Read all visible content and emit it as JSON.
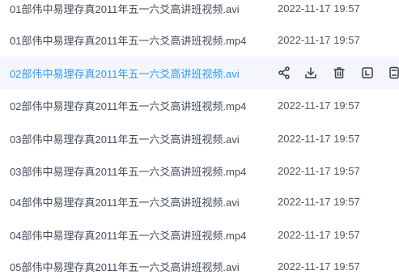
{
  "files": [
    {
      "name": "01部伟中易理存真2011年五一六爻高讲班视频.avi",
      "modified": "2022-11-17  19:57"
    },
    {
      "name": "01部伟中易理存真2011年五一六爻高讲班视频.mp4",
      "modified": "2022-11-17  19:57"
    },
    {
      "name": "02部伟中易理存真2011年五一六爻高讲班视频.avi",
      "modified": "",
      "hovered": true
    },
    {
      "name": "02部伟中易理存真2011年五一六爻高讲班视频.mp4",
      "modified": "2022-11-17  19:57"
    },
    {
      "name": "03部伟中易理存真2011年五一六爻高讲班视频.avi",
      "modified": "2022-11-17  19:57"
    },
    {
      "name": "03部伟中易理存真2011年五一六爻高讲班视频.mp4",
      "modified": "2022-11-17  19:57"
    },
    {
      "name": "04部伟中易理存真2011年五一六爻高讲班视频.avi",
      "modified": "2022-11-17  19:57"
    },
    {
      "name": "04部伟中易理存真2011年五一六爻高讲班视频.mp4",
      "modified": "2022-11-17  19:57"
    },
    {
      "name": "05部伟中易理存真2011年五一六爻高讲班视频.avi",
      "modified": "2022-11-17  19:57"
    }
  ],
  "hover_actions": [
    "share-icon",
    "download-icon",
    "delete-icon",
    "rename-icon",
    "more-icon"
  ],
  "colors": {
    "text": "#454d5a",
    "hover_text": "#2e9bf0",
    "hover_bg": "#f4f6fb"
  }
}
